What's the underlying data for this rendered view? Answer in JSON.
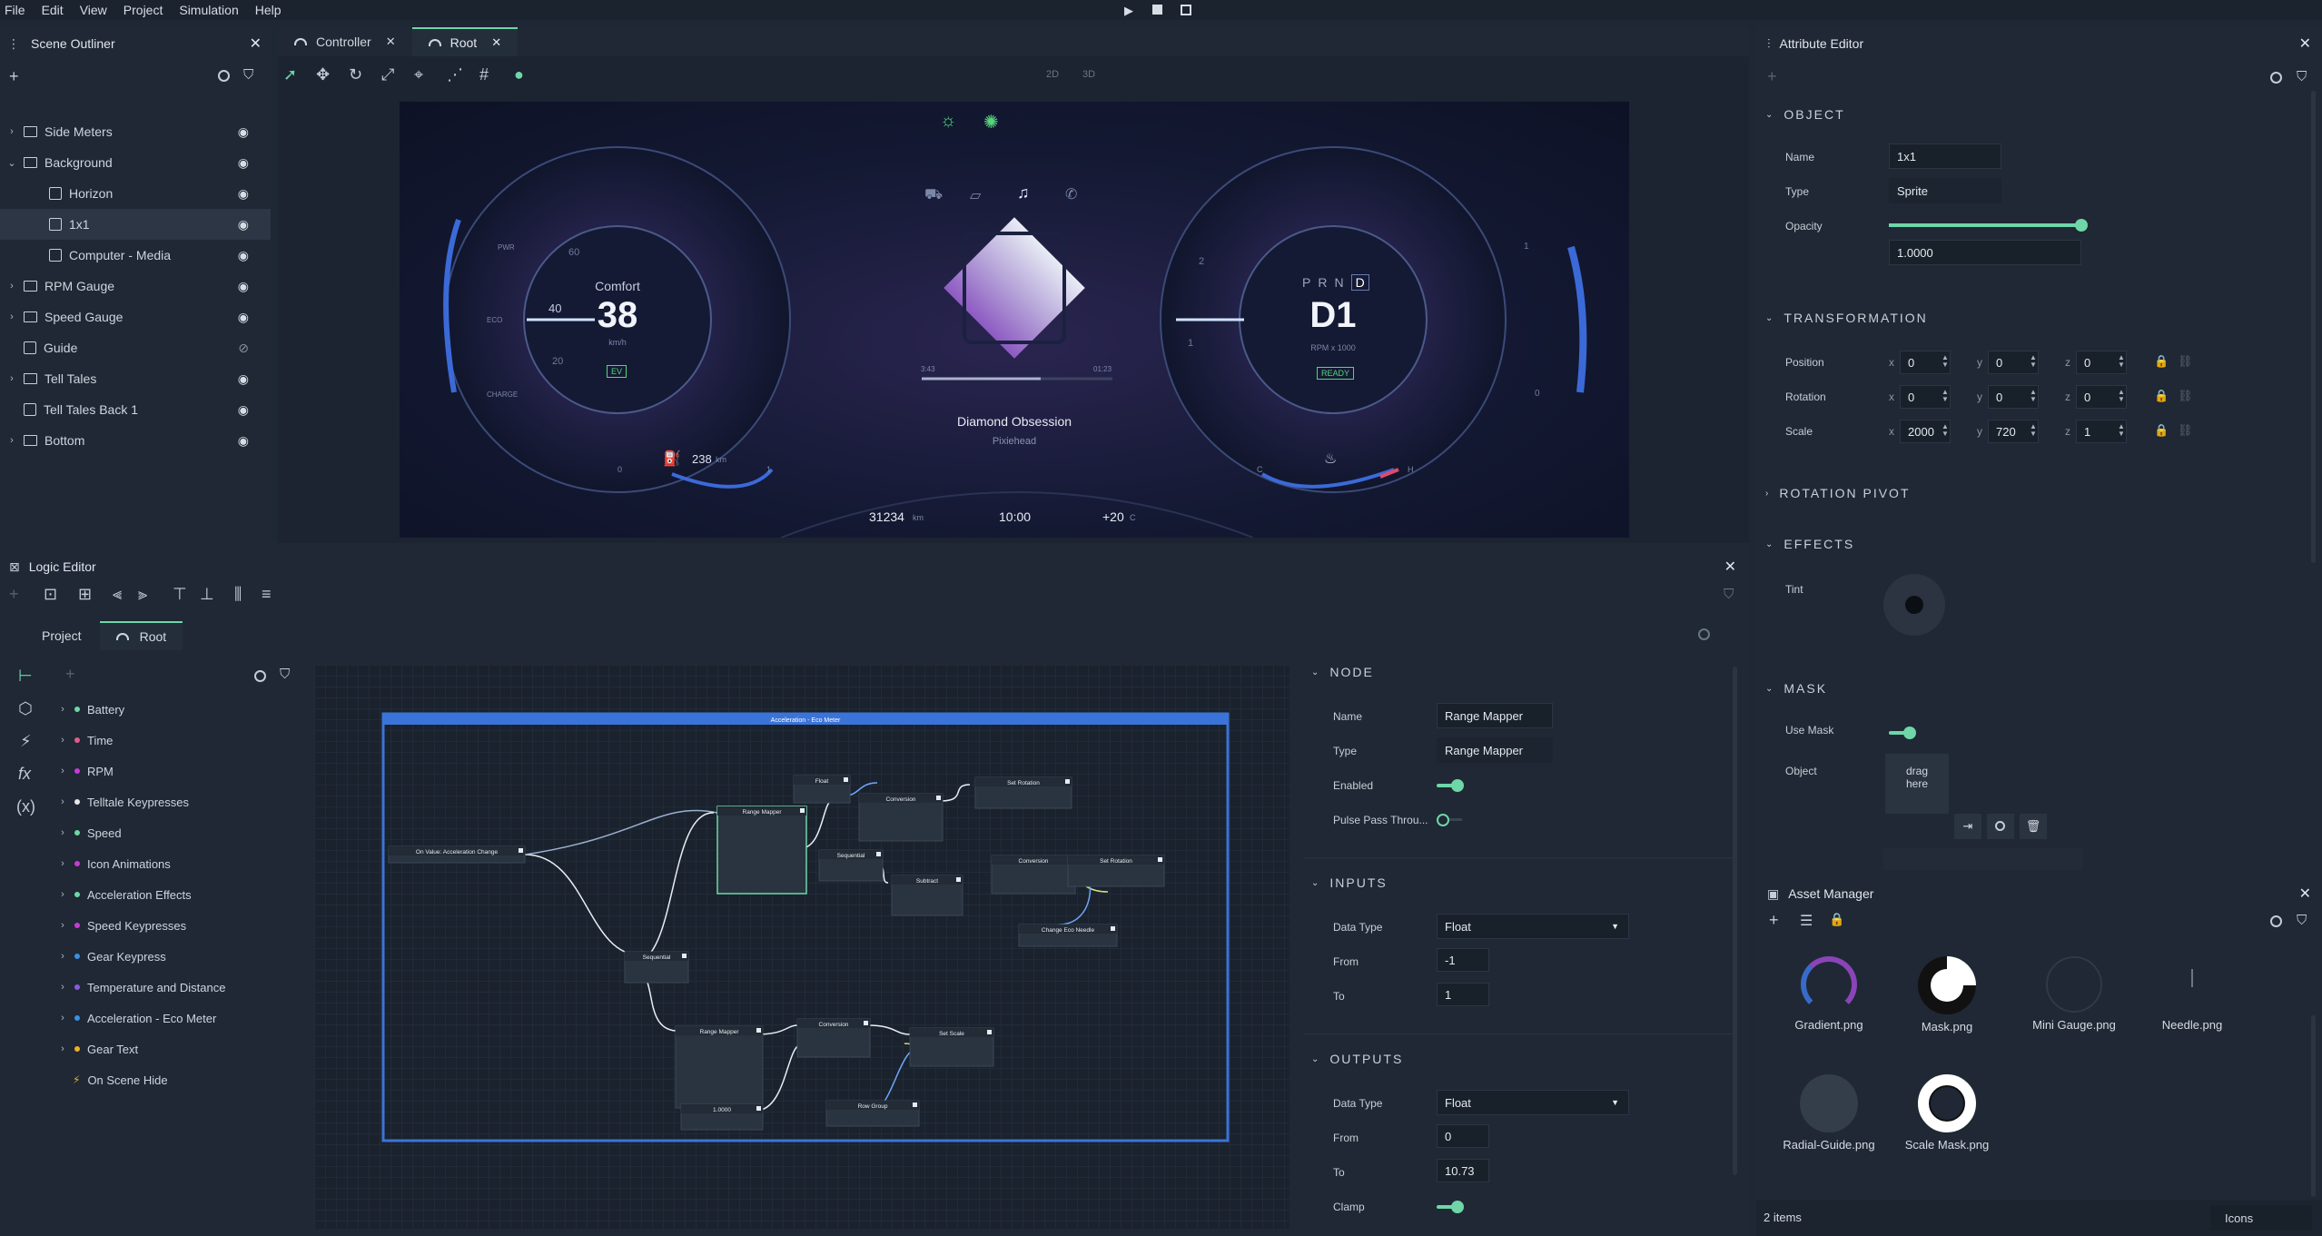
{
  "menu": {
    "items": [
      "File",
      "Edit",
      "View",
      "Project",
      "Simulation",
      "Help"
    ]
  },
  "scene_outliner": {
    "title": "Scene Outliner",
    "items": [
      {
        "label": "Side Meters",
        "type": "folder",
        "depth": 0,
        "expanded": false
      },
      {
        "label": "Background",
        "type": "folder",
        "depth": 0,
        "expanded": true
      },
      {
        "label": "Horizon",
        "type": "image",
        "depth": 1
      },
      {
        "label": "1x1",
        "type": "image",
        "depth": 1,
        "selected": true
      },
      {
        "label": "Computer - Media",
        "type": "image",
        "depth": 1
      },
      {
        "label": "RPM Gauge",
        "type": "folder",
        "depth": 0,
        "expanded": false
      },
      {
        "label": "Speed Gauge",
        "type": "folder",
        "depth": 0,
        "expanded": false
      },
      {
        "label": "Guide",
        "type": "image",
        "depth": 0,
        "hidden": true
      },
      {
        "label": "Tell Tales",
        "type": "folder",
        "depth": 0,
        "expanded": false
      },
      {
        "label": "Tell Tales Back 1",
        "type": "image",
        "depth": 0
      },
      {
        "label": "Bottom",
        "type": "folder",
        "depth": 0,
        "expanded": false
      }
    ]
  },
  "tabs": [
    {
      "label": "Controller"
    },
    {
      "label": "Root",
      "active": true
    }
  ],
  "view_modes": {
    "2d": "2D",
    "3d": "3D"
  },
  "cluster": {
    "left_mode": "Comfort",
    "speed": "38",
    "speed_unit": "km/h",
    "ev": "EV",
    "gear_letters": [
      "P",
      "R",
      "N",
      "D"
    ],
    "gear": "D1",
    "rpm_unit": "RPM x 1000",
    "ready": "READY",
    "range": "238",
    "range_unit": "km",
    "song": "Diamond Obsession",
    "artist": "Pixiehead",
    "time_elapsed": "3:43",
    "time_total": "01:23",
    "odometer": "31234",
    "odo_unit": "km",
    "clock": "10:00",
    "temp": "+20",
    "temp_unit": "C",
    "scale_left": [
      "PWR",
      "ECO",
      "CHARGE"
    ],
    "ticks_left": [
      "60",
      "40",
      "20"
    ],
    "ticks_right": [
      "2",
      "1"
    ],
    "fuel_labels": [
      "0",
      "1"
    ],
    "temp_labels": [
      "C",
      "H"
    ],
    "side_right": [
      "1",
      "0"
    ]
  },
  "attribute_editor": {
    "title": "Attribute Editor",
    "object": {
      "section": "OBJECT",
      "name_label": "Name",
      "name": "1x1",
      "type_label": "Type",
      "type": "Sprite",
      "opacity_label": "Opacity",
      "opacity": "1.0000",
      "opacity_level": 1.0
    },
    "transformation": {
      "section": "TRANSFORMATION",
      "rows": [
        {
          "label": "Position",
          "x": "0",
          "y": "0",
          "z": "0"
        },
        {
          "label": "Rotation",
          "x": "0",
          "y": "0",
          "z": "0"
        },
        {
          "label": "Scale",
          "x": "2000",
          "y": "720",
          "z": "1"
        }
      ],
      "axes": [
        "x",
        "y",
        "z"
      ]
    },
    "rotation_pivot": "ROTATION PIVOT",
    "effects": {
      "section": "EFFECTS",
      "tint_label": "Tint"
    },
    "mask": {
      "section": "MASK",
      "use_mask_label": "Use Mask",
      "object_label": "Object",
      "drop_text": "drag here"
    }
  },
  "asset_manager": {
    "title": "Asset Manager",
    "assets": [
      "Gradient.png",
      "Mask.png",
      "Mini Gauge.png",
      "Needle.png",
      "Radial-Guide.png",
      "Scale Mask.png"
    ],
    "count": "2 items",
    "view": "Icons"
  },
  "logic_editor": {
    "title": "Logic Editor",
    "tabs": [
      "Project",
      "Root"
    ],
    "tree": [
      {
        "label": "Battery",
        "color": "#6fd6a8"
      },
      {
        "label": "Time",
        "color": "#e05c8c"
      },
      {
        "label": "RPM",
        "color": "#c93ad8"
      },
      {
        "label": "Telltale Keypresses",
        "color": "#e8e8e8"
      },
      {
        "label": "Speed",
        "color": "#6fd6a8"
      },
      {
        "label": "Icon Animations",
        "color": "#c93ad8"
      },
      {
        "label": "Acceleration Effects",
        "color": "#6fd6a8"
      },
      {
        "label": "Speed Keypresses",
        "color": "#c93ad8"
      },
      {
        "label": "Gear Keypress",
        "color": "#3b8fe0"
      },
      {
        "label": "Temperature and Distance",
        "color": "#8a5be0"
      },
      {
        "label": "Acceleration - Eco Meter",
        "color": "#3b8fe0"
      },
      {
        "label": "Gear Text",
        "color": "#f0b020"
      },
      {
        "label": "On Scene Hide",
        "color": "#f0b020",
        "event": true
      }
    ],
    "graph": {
      "group_title": "Acceleration - Eco Meter",
      "nodes": {
        "on_value": "On Value: Acceleration Change",
        "range_mapper": "Range Mapper",
        "range_mapper2": "Range Mapper",
        "sequential": "Sequential",
        "sequential2": "Sequential",
        "conversion": "Conversion",
        "conversion2": "Conversion",
        "conversion3": "Conversion",
        "set_rotation": "Set Rotation",
        "set_rotation2": "Set Rotation",
        "set_scale": "Set Scale",
        "subtract": "Subtract",
        "float": "Float",
        "change_eco": "Change Eco Needle",
        "row_group": "Row Group",
        "const": "1.0000"
      }
    },
    "node_props": {
      "node_section": "NODE",
      "name_label": "Name",
      "name": "Range Mapper",
      "type_label": "Type",
      "type": "Range Mapper",
      "enabled_label": "Enabled",
      "pulse_label": "Pulse Pass Throu...",
      "inputs_section": "INPUTS",
      "in_dtype_label": "Data Type",
      "in_dtype": "Float",
      "in_from_label": "From",
      "in_from": "-1",
      "in_to_label": "To",
      "in_to": "1",
      "outputs_section": "OUTPUTS",
      "out_dtype_label": "Data Type",
      "out_dtype": "Float",
      "out_from_label": "From",
      "out_from": "0",
      "out_to_label": "To",
      "out_to": "10.73",
      "clamp_label": "Clamp"
    }
  },
  "colors": {
    "accent": "#6fd6a8",
    "bg": "#1e2734",
    "panel": "#1f2834",
    "field": "#18202a"
  }
}
